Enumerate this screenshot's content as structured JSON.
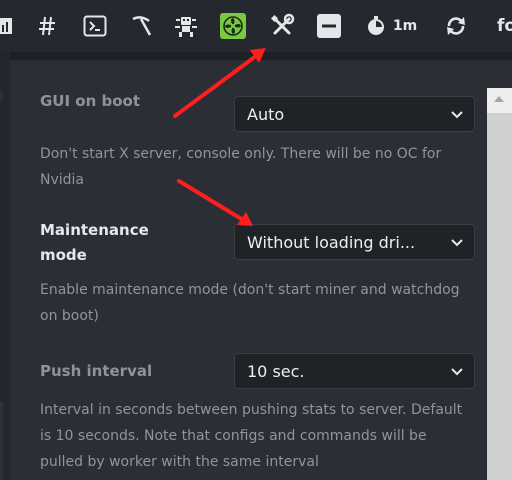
{
  "toolbar": {
    "icons": [
      "chart-icon",
      "hash-icon",
      "terminal-icon",
      "pickaxe-icon",
      "robot-icon",
      "fan-icon",
      "tools-icon",
      "minus-icon",
      "timer-icon",
      "refresh-icon"
    ],
    "timer_label": "1m",
    "overflow_text": "fo",
    "fan_color": "#7ac943",
    "arrow_color": "#ff1e1e"
  },
  "settings": {
    "gui_on_boot": {
      "label": "GUI on boot",
      "value": "Auto",
      "description": "Don't start X server, console only. There will be no OC for Nvidia"
    },
    "maintenance_mode": {
      "label": "Maintenance mode",
      "value": "Without loading dri...",
      "description": "Enable maintenance mode (don't start miner and watchdog on boot)"
    },
    "push_interval": {
      "label": "Push interval",
      "value": "10 sec.",
      "description": "Interval in seconds between pushing stats to server. Default is 10 seconds. Note that configs and commands will be pulled by worker with the same interval"
    }
  }
}
